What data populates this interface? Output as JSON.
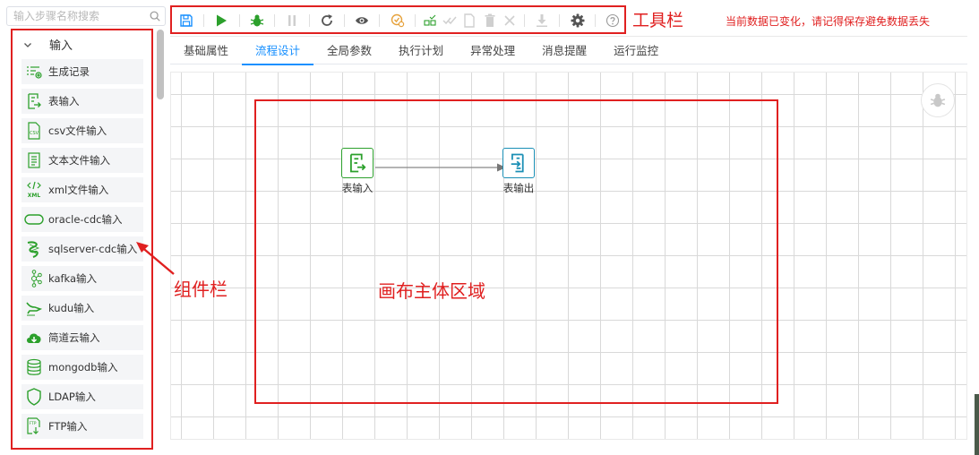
{
  "search": {
    "placeholder": "输入步骤名称搜索"
  },
  "components": {
    "group_label": "输入",
    "items": [
      {
        "label": "生成记录",
        "icon": "generate-record-icon"
      },
      {
        "label": "表输入",
        "icon": "table-input-icon"
      },
      {
        "label": "csv文件输入",
        "icon": "csv-file-icon"
      },
      {
        "label": "文本文件输入",
        "icon": "text-file-icon"
      },
      {
        "label": "xml文件输入",
        "icon": "xml-file-icon"
      },
      {
        "label": "oracle-cdc输入",
        "icon": "oracle-icon"
      },
      {
        "label": "sqlserver-cdc输入",
        "icon": "sqlserver-icon"
      },
      {
        "label": "kafka输入",
        "icon": "kafka-icon"
      },
      {
        "label": "kudu输入",
        "icon": "kudu-icon"
      },
      {
        "label": "简道云输入",
        "icon": "cloud-download-icon"
      },
      {
        "label": "mongodb输入",
        "icon": "database-icon"
      },
      {
        "label": "LDAP输入",
        "icon": "shield-icon"
      },
      {
        "label": "FTP输入",
        "icon": "ftp-file-icon"
      }
    ]
  },
  "toolbar": {
    "warning": "当前数据已变化，请记得保存避免数据丢失",
    "tools": [
      "save-icon",
      "run-icon",
      "debug-icon",
      "pause-icon",
      "refresh-icon",
      "preview-icon",
      "check-config-icon",
      "copy-structure-icon",
      "check-all-icon",
      "file-icon",
      "delete-icon",
      "close-icon",
      "download-icon",
      "settings-icon",
      "help-icon"
    ]
  },
  "tabs": [
    {
      "label": "基础属性",
      "active": false
    },
    {
      "label": "流程设计",
      "active": true
    },
    {
      "label": "全局参数",
      "active": false
    },
    {
      "label": "执行计划",
      "active": false
    },
    {
      "label": "异常处理",
      "active": false
    },
    {
      "label": "消息提醒",
      "active": false
    },
    {
      "label": "运行监控",
      "active": false
    }
  ],
  "canvas": {
    "nodes": [
      {
        "label": "表输入",
        "icon": "table-input-icon",
        "color": "#2ca02c"
      },
      {
        "label": "表输出",
        "icon": "table-output-icon",
        "color": "#1a8fb5"
      }
    ]
  },
  "annotations": {
    "toolbar": "工具栏",
    "components": "组件栏",
    "canvas": "画布主体区域"
  },
  "colors": {
    "accent": "#1890ff",
    "annotation": "#e02020",
    "icon_green": "#2ca02c"
  }
}
